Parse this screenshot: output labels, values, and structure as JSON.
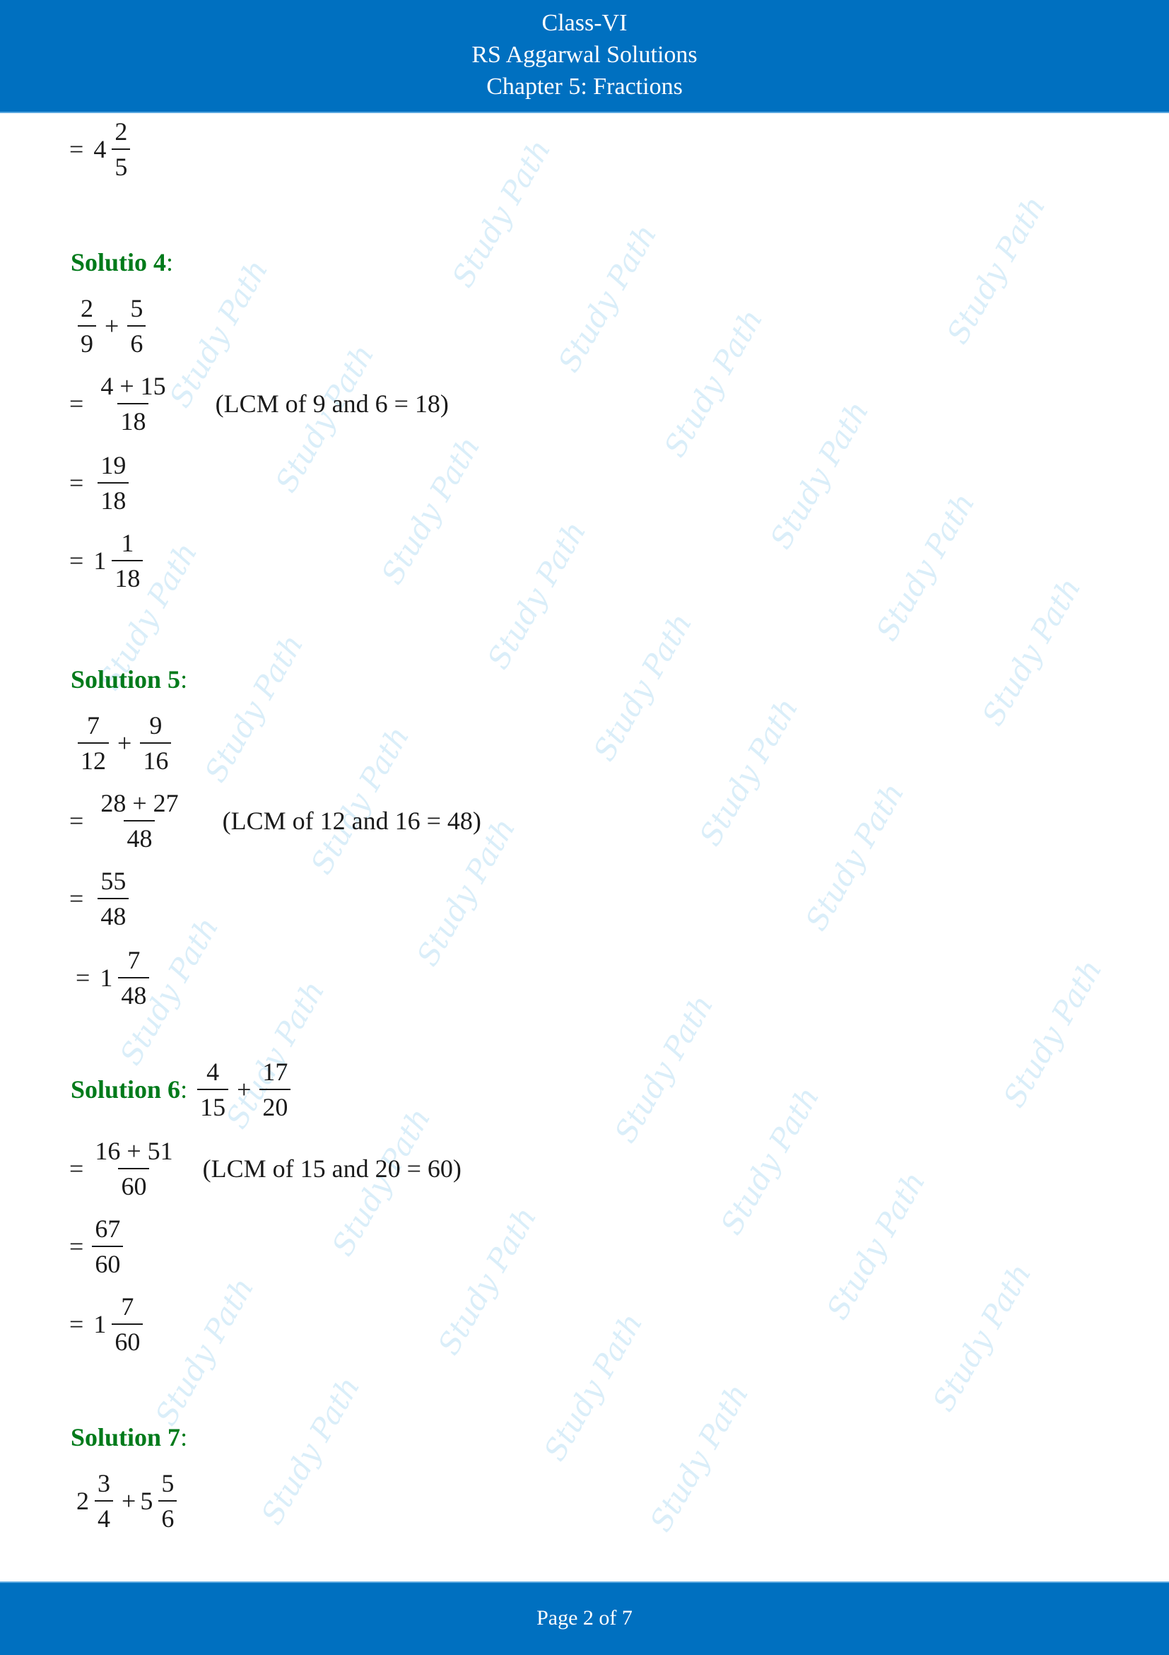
{
  "header": {
    "line1": "Class-VI",
    "line2": "RS Aggarwal Solutions",
    "line3": "Chapter 5: Fractions"
  },
  "watermark": "Study Path",
  "colors": {
    "header_bg": "#0070c0",
    "solution_title": "#007a1a",
    "watermark": "#d4ecf8"
  },
  "carryover": {
    "eq": "=",
    "whole": "4",
    "num": "2",
    "den": "5"
  },
  "solutions": [
    {
      "title": "Solutio 4",
      "colon": ":",
      "problem": {
        "a_num": "2",
        "a_den": "9",
        "op": "+",
        "b_num": "5",
        "b_den": "6"
      },
      "step1": {
        "eq": "=",
        "num": "4 + 15",
        "den": "18",
        "note": "(LCM of 9 and 6 = 18)"
      },
      "step2": {
        "eq": "=",
        "num": "19",
        "den": "18"
      },
      "step3": {
        "eq": "=",
        "whole": "1",
        "num": "1",
        "den": "18"
      }
    },
    {
      "title": "Solution 5",
      "colon": ":",
      "problem": {
        "a_num": "7",
        "a_den": "12",
        "op": "+",
        "b_num": "9",
        "b_den": "16"
      },
      "step1": {
        "eq": "=",
        "num": "28 + 27",
        "den": "48",
        "note": "(LCM of 12 and 16 = 48)"
      },
      "step2": {
        "eq": "=",
        "num": "55",
        "den": "48"
      },
      "step3": {
        "eq": "=",
        "whole": "1",
        "num": "7",
        "den": "48"
      }
    },
    {
      "title": "Solution 6",
      "colon": ":",
      "problem": {
        "a_num": "4",
        "a_den": "15",
        "op": "+",
        "b_num": "17",
        "b_den": "20"
      },
      "step1": {
        "eq": "=",
        "num": "16 + 51",
        "den": "60",
        "note": "(LCM of 15 and 20 = 60)"
      },
      "step2": {
        "eq": "=",
        "num": "67",
        "den": "60"
      },
      "step3": {
        "eq": "=",
        "whole": "1",
        "num": "7",
        "den": "60"
      }
    },
    {
      "title": "Solution 7",
      "colon": ":",
      "problem": {
        "a_whole": "2",
        "a_num": "3",
        "a_den": "4",
        "op": "+",
        "b_whole": "5",
        "b_num": "5",
        "b_den": "6"
      }
    }
  ],
  "footer": {
    "page_label": "Page 2 of 7"
  }
}
